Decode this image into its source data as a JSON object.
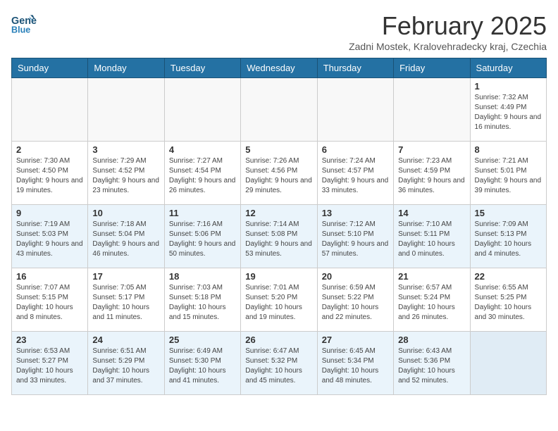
{
  "header": {
    "logo_text_general": "General",
    "logo_text_blue": "Blue",
    "month_year": "February 2025",
    "location": "Zadni Mostek, Kralovehradecky kraj, Czechia"
  },
  "weekdays": [
    "Sunday",
    "Monday",
    "Tuesday",
    "Wednesday",
    "Thursday",
    "Friday",
    "Saturday"
  ],
  "weeks": [
    {
      "alt": false,
      "days": [
        {
          "num": "",
          "info": ""
        },
        {
          "num": "",
          "info": ""
        },
        {
          "num": "",
          "info": ""
        },
        {
          "num": "",
          "info": ""
        },
        {
          "num": "",
          "info": ""
        },
        {
          "num": "",
          "info": ""
        },
        {
          "num": "1",
          "info": "Sunrise: 7:32 AM\nSunset: 4:49 PM\nDaylight: 9 hours and 16 minutes."
        }
      ]
    },
    {
      "alt": false,
      "days": [
        {
          "num": "2",
          "info": "Sunrise: 7:30 AM\nSunset: 4:50 PM\nDaylight: 9 hours and 19 minutes."
        },
        {
          "num": "3",
          "info": "Sunrise: 7:29 AM\nSunset: 4:52 PM\nDaylight: 9 hours and 23 minutes."
        },
        {
          "num": "4",
          "info": "Sunrise: 7:27 AM\nSunset: 4:54 PM\nDaylight: 9 hours and 26 minutes."
        },
        {
          "num": "5",
          "info": "Sunrise: 7:26 AM\nSunset: 4:56 PM\nDaylight: 9 hours and 29 minutes."
        },
        {
          "num": "6",
          "info": "Sunrise: 7:24 AM\nSunset: 4:57 PM\nDaylight: 9 hours and 33 minutes."
        },
        {
          "num": "7",
          "info": "Sunrise: 7:23 AM\nSunset: 4:59 PM\nDaylight: 9 hours and 36 minutes."
        },
        {
          "num": "8",
          "info": "Sunrise: 7:21 AM\nSunset: 5:01 PM\nDaylight: 9 hours and 39 minutes."
        }
      ]
    },
    {
      "alt": true,
      "days": [
        {
          "num": "9",
          "info": "Sunrise: 7:19 AM\nSunset: 5:03 PM\nDaylight: 9 hours and 43 minutes."
        },
        {
          "num": "10",
          "info": "Sunrise: 7:18 AM\nSunset: 5:04 PM\nDaylight: 9 hours and 46 minutes."
        },
        {
          "num": "11",
          "info": "Sunrise: 7:16 AM\nSunset: 5:06 PM\nDaylight: 9 hours and 50 minutes."
        },
        {
          "num": "12",
          "info": "Sunrise: 7:14 AM\nSunset: 5:08 PM\nDaylight: 9 hours and 53 minutes."
        },
        {
          "num": "13",
          "info": "Sunrise: 7:12 AM\nSunset: 5:10 PM\nDaylight: 9 hours and 57 minutes."
        },
        {
          "num": "14",
          "info": "Sunrise: 7:10 AM\nSunset: 5:11 PM\nDaylight: 10 hours and 0 minutes."
        },
        {
          "num": "15",
          "info": "Sunrise: 7:09 AM\nSunset: 5:13 PM\nDaylight: 10 hours and 4 minutes."
        }
      ]
    },
    {
      "alt": false,
      "days": [
        {
          "num": "16",
          "info": "Sunrise: 7:07 AM\nSunset: 5:15 PM\nDaylight: 10 hours and 8 minutes."
        },
        {
          "num": "17",
          "info": "Sunrise: 7:05 AM\nSunset: 5:17 PM\nDaylight: 10 hours and 11 minutes."
        },
        {
          "num": "18",
          "info": "Sunrise: 7:03 AM\nSunset: 5:18 PM\nDaylight: 10 hours and 15 minutes."
        },
        {
          "num": "19",
          "info": "Sunrise: 7:01 AM\nSunset: 5:20 PM\nDaylight: 10 hours and 19 minutes."
        },
        {
          "num": "20",
          "info": "Sunrise: 6:59 AM\nSunset: 5:22 PM\nDaylight: 10 hours and 22 minutes."
        },
        {
          "num": "21",
          "info": "Sunrise: 6:57 AM\nSunset: 5:24 PM\nDaylight: 10 hours and 26 minutes."
        },
        {
          "num": "22",
          "info": "Sunrise: 6:55 AM\nSunset: 5:25 PM\nDaylight: 10 hours and 30 minutes."
        }
      ]
    },
    {
      "alt": true,
      "days": [
        {
          "num": "23",
          "info": "Sunrise: 6:53 AM\nSunset: 5:27 PM\nDaylight: 10 hours and 33 minutes."
        },
        {
          "num": "24",
          "info": "Sunrise: 6:51 AM\nSunset: 5:29 PM\nDaylight: 10 hours and 37 minutes."
        },
        {
          "num": "25",
          "info": "Sunrise: 6:49 AM\nSunset: 5:30 PM\nDaylight: 10 hours and 41 minutes."
        },
        {
          "num": "26",
          "info": "Sunrise: 6:47 AM\nSunset: 5:32 PM\nDaylight: 10 hours and 45 minutes."
        },
        {
          "num": "27",
          "info": "Sunrise: 6:45 AM\nSunset: 5:34 PM\nDaylight: 10 hours and 48 minutes."
        },
        {
          "num": "28",
          "info": "Sunrise: 6:43 AM\nSunset: 5:36 PM\nDaylight: 10 hours and 52 minutes."
        },
        {
          "num": "",
          "info": ""
        }
      ]
    }
  ]
}
